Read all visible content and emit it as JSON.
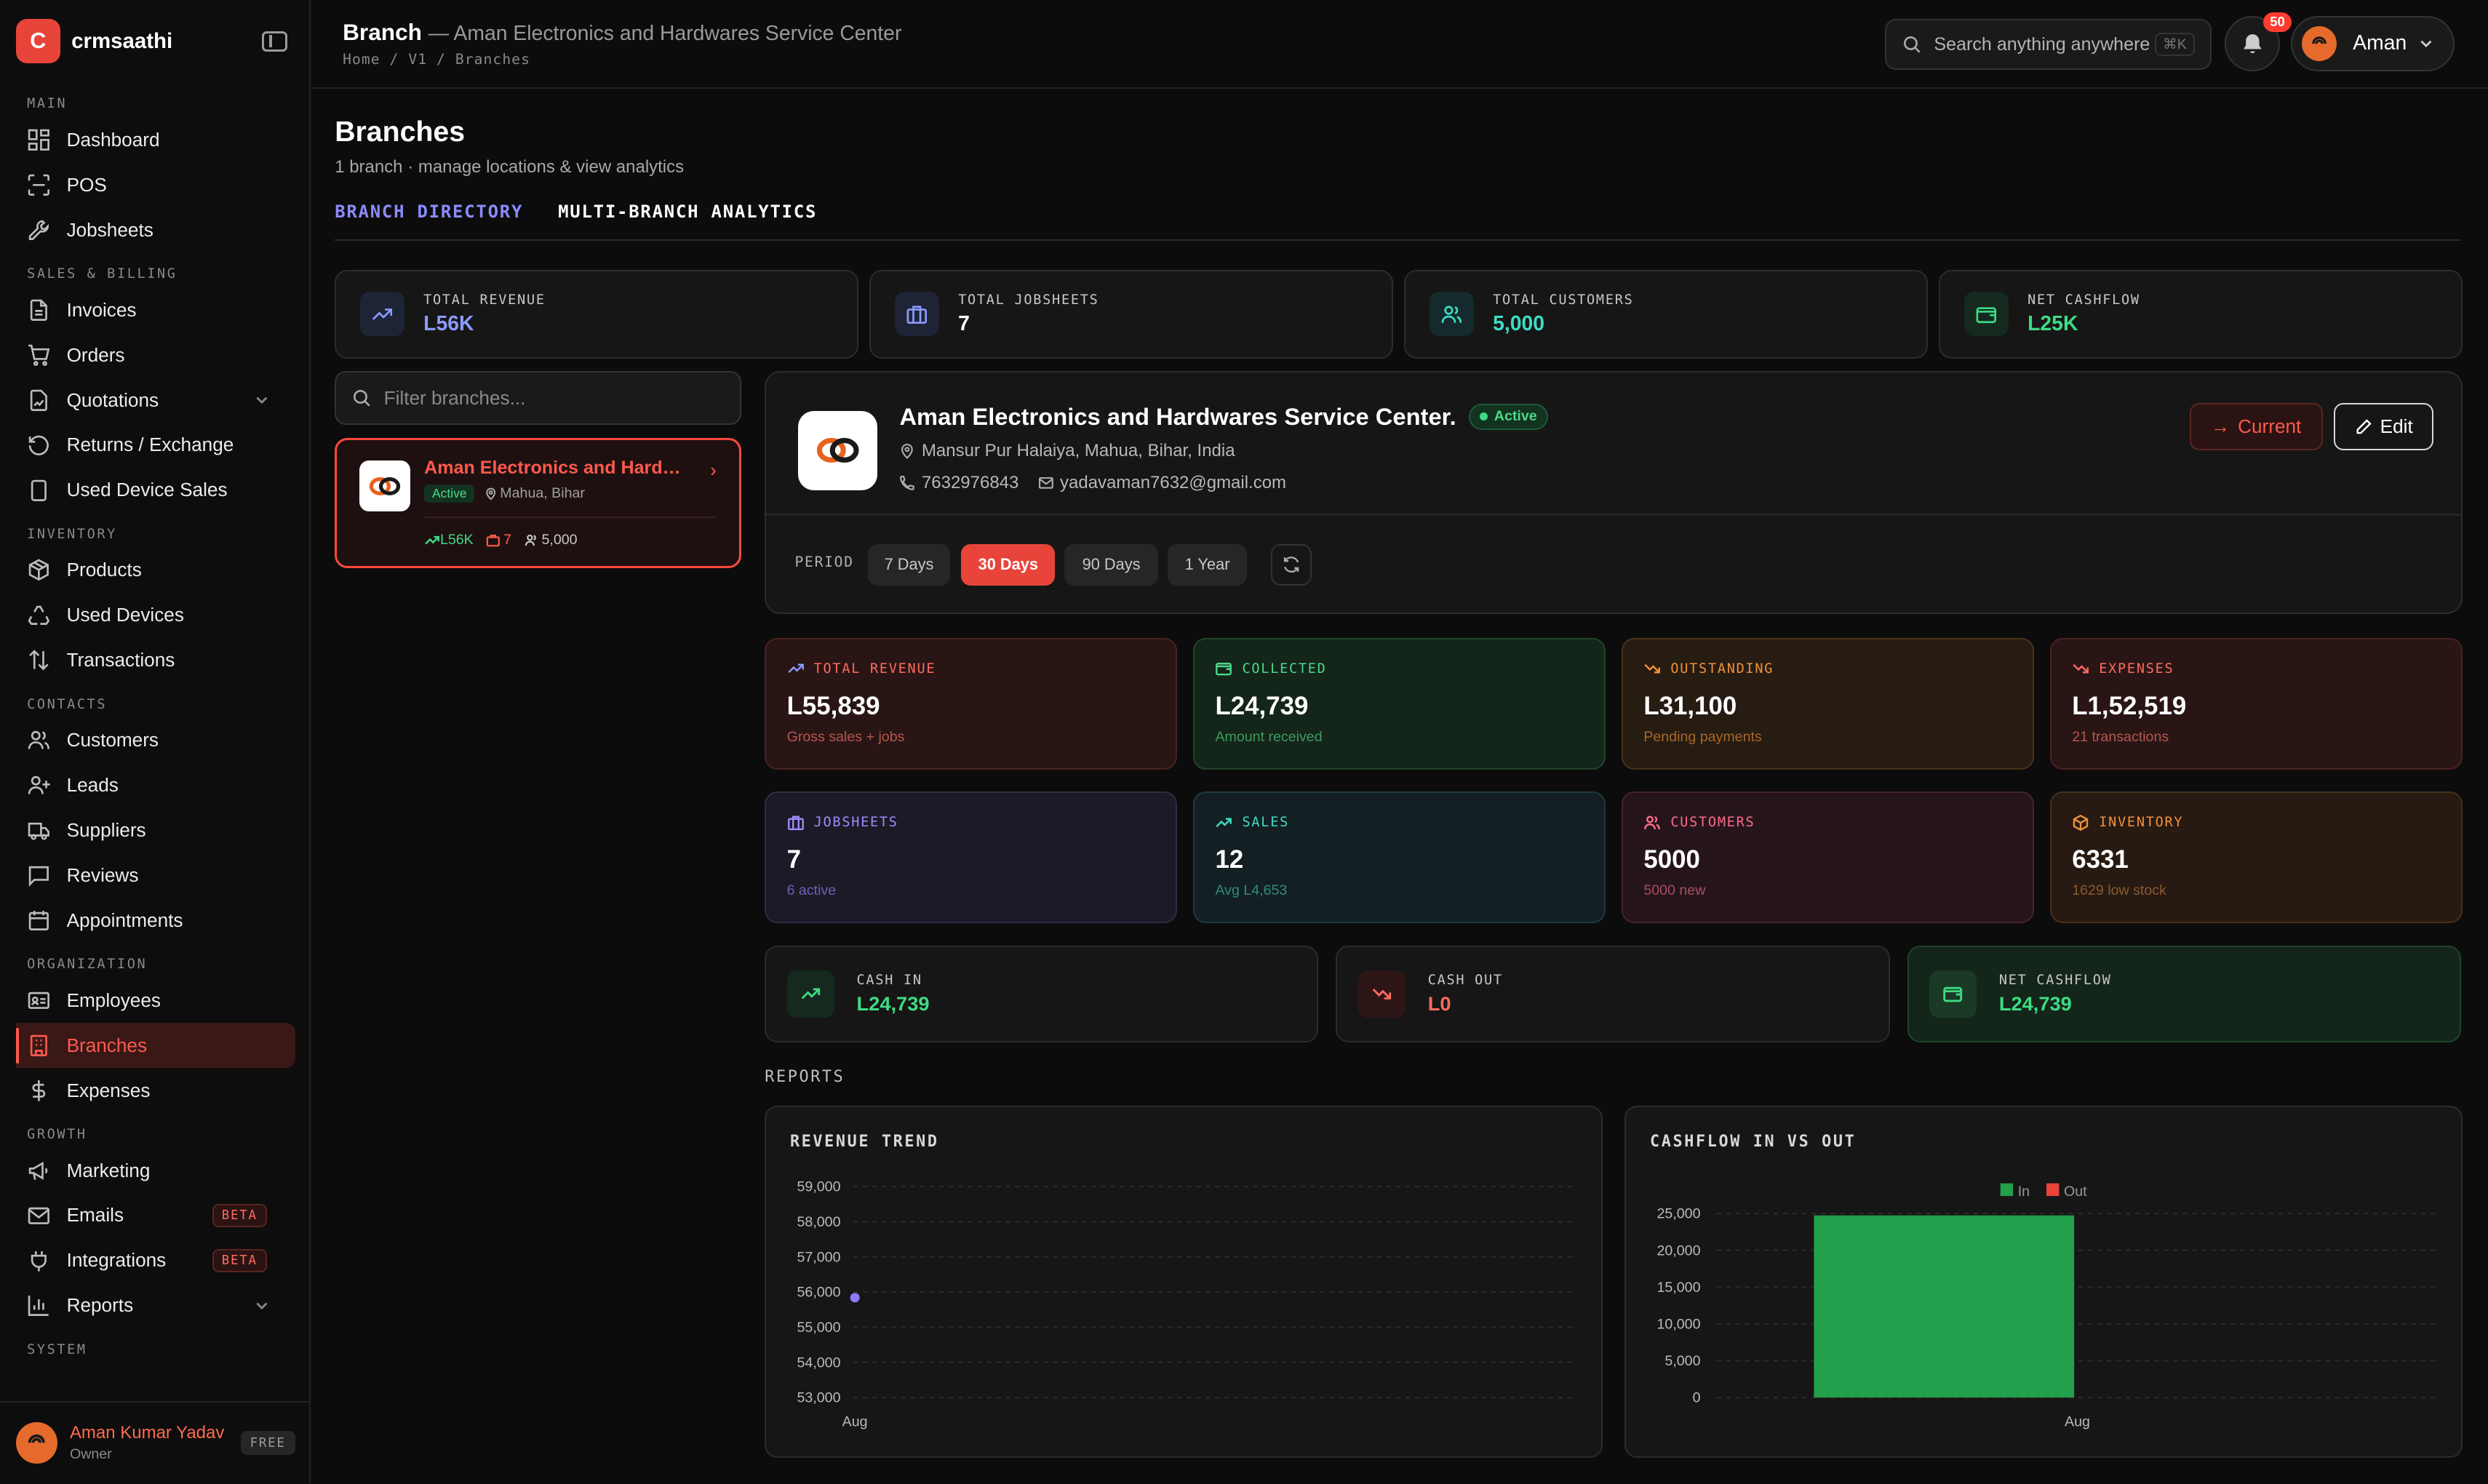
{
  "app": {
    "name": "crmsaathi",
    "logo_letter": "C"
  },
  "sidebar": {
    "sections": {
      "main": "MAIN",
      "sales": "SALES & BILLING",
      "inventory": "INVENTORY",
      "contacts": "CONTACTS",
      "organization": "ORGANIZATION",
      "growth": "GROWTH",
      "system": "SYSTEM"
    },
    "items": {
      "dashboard": "Dashboard",
      "pos": "POS",
      "jobsheets": "Jobsheets",
      "invoices": "Invoices",
      "orders": "Orders",
      "quotations": "Quotations",
      "returns": "Returns / Exchange",
      "used_device_sales": "Used Device Sales",
      "products": "Products",
      "used_devices": "Used Devices",
      "transactions": "Transactions",
      "customers": "Customers",
      "leads": "Leads",
      "suppliers": "Suppliers",
      "reviews": "Reviews",
      "appointments": "Appointments",
      "employees": "Employees",
      "branches": "Branches",
      "expenses": "Expenses",
      "marketing": "Marketing",
      "emails": "Emails",
      "integrations": "Integrations",
      "reports": "Reports"
    },
    "beta": "BETA",
    "user": {
      "name": "Aman Kumar Yadav",
      "role": "Owner",
      "plan": "FREE"
    }
  },
  "header": {
    "title": "Branch",
    "subtitle": "— Aman Electronics and Hardwares Service Center",
    "breadcrumb": "Home  /  V1  /  Branches",
    "search_placeholder": "Search anything anywhere",
    "shortcut": "⌘K",
    "notifications": "50",
    "user": "Aman"
  },
  "page": {
    "title": "Branches",
    "subtitle": "1 branch · manage locations & view analytics",
    "tabs": [
      "BRANCH DIRECTORY",
      "MULTI-BRANCH ANALYTICS"
    ]
  },
  "stats": [
    {
      "label": "TOTAL REVENUE",
      "value": "L56K",
      "color": "#8b9bff"
    },
    {
      "label": "TOTAL JOBSHEETS",
      "value": "7",
      "color": "#ffffff"
    },
    {
      "label": "TOTAL CUSTOMERS",
      "value": "5,000",
      "color": "#3ddcc4"
    },
    {
      "label": "NET CASHFLOW",
      "value": "L25K",
      "color": "#3ddc84"
    }
  ],
  "filter_placeholder": "Filter branches...",
  "branch_card": {
    "name": "Aman Electronics and Hardwares Service Center.",
    "status": "Active",
    "location": "Mahua, Bihar",
    "revenue": "L56K",
    "jobsheets": "7",
    "customers": "5,000"
  },
  "detail": {
    "name": "Aman Electronics and Hardwares Service Center.",
    "status": "Active",
    "address": "Mansur Pur Halaiya, Mahua, Bihar, India",
    "phone": "7632976843",
    "email": "yadavaman7632@gmail.com",
    "current": "Current",
    "edit": "Edit",
    "period_label": "PERIOD",
    "periods": [
      "7 Days",
      "30 Days",
      "90 Days",
      "1 Year"
    ],
    "selected_period": "30 Days"
  },
  "metrics": [
    {
      "label": "TOTAL REVENUE",
      "value": "L55,839",
      "note": "Gross sales + jobs"
    },
    {
      "label": "COLLECTED",
      "value": "L24,739",
      "note": "Amount received"
    },
    {
      "label": "OUTSTANDING",
      "value": "L31,100",
      "note": "Pending payments"
    },
    {
      "label": "EXPENSES",
      "value": "L1,52,519",
      "note": "21 transactions"
    },
    {
      "label": "JOBSHEETS",
      "value": "7",
      "note": "6 active"
    },
    {
      "label": "SALES",
      "value": "12",
      "note": "Avg L4,653"
    },
    {
      "label": "CUSTOMERS",
      "value": "5000",
      "note": "5000 new"
    },
    {
      "label": "INVENTORY",
      "value": "6331",
      "note": "1629 low stock"
    }
  ],
  "cash": [
    {
      "label": "CASH IN",
      "value": "L24,739"
    },
    {
      "label": "CASH OUT",
      "value": "L0"
    },
    {
      "label": "NET CASHFLOW",
      "value": "L24,739"
    }
  ],
  "reports_label": "REPORTS",
  "chart_data": [
    {
      "type": "line",
      "title": "REVENUE TREND",
      "x": [
        "Aug"
      ],
      "series": [
        {
          "values": [
            55839
          ]
        }
      ],
      "ylim": [
        53000,
        59000
      ],
      "yticks": [
        "59,000",
        "58,000",
        "57,000",
        "56,000",
        "55,000",
        "54,000",
        "53,000"
      ],
      "grid": true
    },
    {
      "type": "bar",
      "title": "CASHFLOW IN VS OUT",
      "categories": [
        "Aug"
      ],
      "series": [
        {
          "name": "In",
          "values": [
            24739
          ],
          "color": "#22a04b"
        },
        {
          "name": "Out",
          "values": [
            0
          ],
          "color": "#e8443a"
        }
      ],
      "ylim": [
        0,
        25000
      ],
      "yticks": [
        "25,000",
        "20,000",
        "15,000",
        "10,000",
        "5,000",
        "0"
      ],
      "legend": "top",
      "grid": true
    }
  ]
}
